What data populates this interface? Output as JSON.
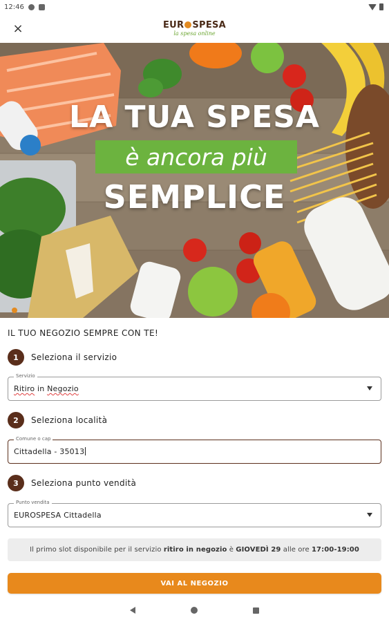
{
  "status_bar": {
    "time": "12:46"
  },
  "header": {
    "close_label": "×",
    "logo_main_1": "EUR",
    "logo_main_2": "SPESA",
    "logo_sub": "la spesa online"
  },
  "hero": {
    "line1": "LA TUA SPESA",
    "line2": "è ancora più",
    "line3": "SEMPLICE"
  },
  "form": {
    "tagline": "IL TUO NEGOZIO SEMPRE CON TE!",
    "steps": [
      {
        "number": "1",
        "label": "Seleziona il servizio"
      },
      {
        "number": "2",
        "label": "Seleziona località"
      },
      {
        "number": "3",
        "label": "Seleziona punto vendità"
      }
    ],
    "service": {
      "label": "Servizio",
      "value_word1": "Ritiro",
      "value_word2": " in ",
      "value_word3": "Negozio"
    },
    "location": {
      "label": "Comune o cap",
      "value": "Cittadella - 35013"
    },
    "store": {
      "label": "Punto vendita",
      "value": "EUROSPESA Cittadella"
    },
    "info": {
      "part1": "Il primo slot disponibile per il servizio ",
      "part2": "ritiro in negozio",
      "part3": " è ",
      "part4": "GIOVEDÌ 29",
      "part5": " alle ore ",
      "part6": "17:00-19:00"
    },
    "cta_label": "VAI AL NEGOZIO"
  },
  "colors": {
    "brand_brown": "#5a2e1b",
    "brand_orange": "#e8891c",
    "brand_green": "#6cb33f",
    "info_bg": "#ededed"
  },
  "icons": [
    "close-icon",
    "dropdown-arrow-icon",
    "nav-back-icon",
    "nav-home-icon",
    "nav-recent-icon"
  ]
}
